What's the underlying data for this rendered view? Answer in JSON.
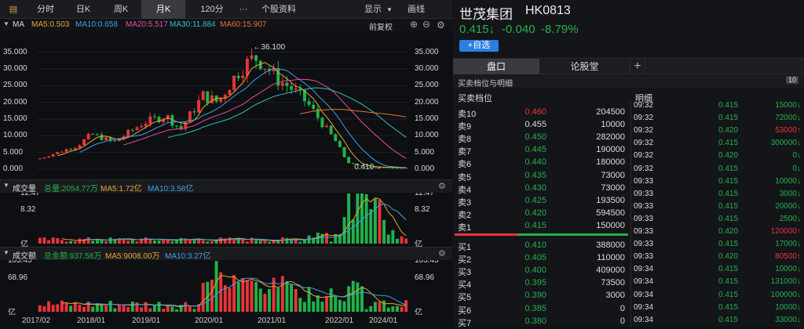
{
  "colors": {
    "up": "#e8343a",
    "down": "#21b24b",
    "ma5": "#e8a531",
    "ma10": "#3fa0e8",
    "ma20": "#e64d9e",
    "ma30": "#33c0c0",
    "ma60": "#e8732e",
    "vol_ma5": "#e8a531",
    "vol_ma10": "#3fa0e8"
  },
  "toolbar": {
    "tabs": [
      "分时",
      "日K",
      "周K",
      "月K",
      "120分",
      "···",
      "个股资料"
    ],
    "active": "月K",
    "display": "显示",
    "display_arrow": "▾",
    "draw": "画线"
  },
  "ma_header": {
    "title": "MA",
    "ma5": "MA5:0.503",
    "ma10": "MA10:0.658",
    "ma20": "MA20:5.517",
    "ma30": "MA30:11.884",
    "ma60": "MA60:15.907",
    "adjust": "前复权"
  },
  "price_axis": {
    "ticks": [
      "35.000",
      "30.000",
      "25.000",
      "20.000",
      "15.000",
      "10.000",
      "5.000",
      "0.000"
    ],
    "high_label": "←36.100",
    "low_label": "0.410→"
  },
  "volume_panel": {
    "title": "成交量",
    "total": "总量:2054.77万",
    "ma5": "MA5:1.72亿",
    "ma10": "MA10:3.58亿",
    "ticks": [
      "12.47",
      "8.32",
      "亿"
    ]
  },
  "amount_panel": {
    "title": "成交额",
    "total": "总金额:937.58万",
    "ma5": "MA5:9008.00万",
    "ma10": "MA10:3.27亿",
    "ticks": [
      "103.45",
      "68.96",
      "亿"
    ]
  },
  "x_axis": [
    "2017/02",
    "2018/01",
    "2019/01",
    "2020/01",
    "2021/01",
    "2022/01",
    "2024/01"
  ],
  "chart_data": {
    "type": "candlestick",
    "title": "",
    "ylim": [
      0,
      37
    ],
    "months": 84,
    "high": 36.1,
    "low": 0.41,
    "ma_series_names": [
      "MA5",
      "MA10",
      "MA20",
      "MA30",
      "MA60"
    ],
    "volume_ylim": [
      0,
      12.47
    ],
    "amount_ylim": [
      0,
      103.45
    ]
  },
  "quote": {
    "name": "世茂集团",
    "code": "HK0813",
    "price": "0.415↓",
    "change": "-0.040",
    "pct": "-8.79%",
    "add_button": "+自选"
  },
  "right_tabs": {
    "tab1": "盘口",
    "tab2": "论股堂",
    "plus": "+"
  },
  "section_title": "买卖档位与明细",
  "badge": "10",
  "col_headers": {
    "levels": "买卖档位",
    "detail": "明细"
  },
  "asks": [
    {
      "label": "卖10",
      "price": "0.460",
      "vol": "204500"
    },
    {
      "label": "卖9",
      "price": "0.455",
      "vol": "10000"
    },
    {
      "label": "卖8",
      "price": "0.450",
      "vol": "282000"
    },
    {
      "label": "卖7",
      "price": "0.445",
      "vol": "190000"
    },
    {
      "label": "卖6",
      "price": "0.440",
      "vol": "180000"
    },
    {
      "label": "卖5",
      "price": "0.435",
      "vol": "73000"
    },
    {
      "label": "卖4",
      "price": "0.430",
      "vol": "73000"
    },
    {
      "label": "卖3",
      "price": "0.425",
      "vol": "193500"
    },
    {
      "label": "卖2",
      "price": "0.420",
      "vol": "594500"
    },
    {
      "label": "卖1",
      "price": "0.415",
      "vol": "150000"
    }
  ],
  "bids": [
    {
      "label": "买1",
      "price": "0.410",
      "vol": "388000"
    },
    {
      "label": "买2",
      "price": "0.405",
      "vol": "110000"
    },
    {
      "label": "买3",
      "price": "0.400",
      "vol": "409000"
    },
    {
      "label": "买4",
      "price": "0.395",
      "vol": "73500"
    },
    {
      "label": "买5",
      "price": "0.390",
      "vol": "3000"
    },
    {
      "label": "买6",
      "price": "0.385",
      "vol": "0"
    },
    {
      "label": "买7",
      "price": "0.380",
      "vol": "0"
    }
  ],
  "details": [
    {
      "time": "09:32",
      "price": "0.415",
      "vol": "15000↓"
    },
    {
      "time": "09:32",
      "price": "0.415",
      "vol": "72000↓"
    },
    {
      "time": "09:32",
      "price": "0.420",
      "vol": "53000↑"
    },
    {
      "time": "09:32",
      "price": "0.415",
      "vol": "300000↓"
    },
    {
      "time": "09:32",
      "price": "0.420",
      "vol": "0↓"
    },
    {
      "time": "09:32",
      "price": "0.415",
      "vol": "0↓"
    },
    {
      "time": "09:33",
      "price": "0.415",
      "vol": "10000↓"
    },
    {
      "time": "09:33",
      "price": "0.415",
      "vol": "3000↓"
    },
    {
      "time": "09:33",
      "price": "0.415",
      "vol": "20000↓"
    },
    {
      "time": "09:33",
      "price": "0.415",
      "vol": "2500↓"
    },
    {
      "time": "09:33",
      "price": "0.420",
      "vol": "120000↑"
    },
    {
      "time": "09:33",
      "price": "0.415",
      "vol": "17000↓"
    },
    {
      "time": "09:33",
      "price": "0.420",
      "vol": "80500↑"
    },
    {
      "time": "09:34",
      "price": "0.415",
      "vol": "10000↓"
    },
    {
      "time": "09:34",
      "price": "0.415",
      "vol": "131000↓"
    },
    {
      "time": "09:34",
      "price": "0.415",
      "vol": "100000↓"
    },
    {
      "time": "09:34",
      "price": "0.415",
      "vol": "10000↓"
    },
    {
      "time": "09:34",
      "price": "0.415",
      "vol": "33000↓"
    }
  ]
}
